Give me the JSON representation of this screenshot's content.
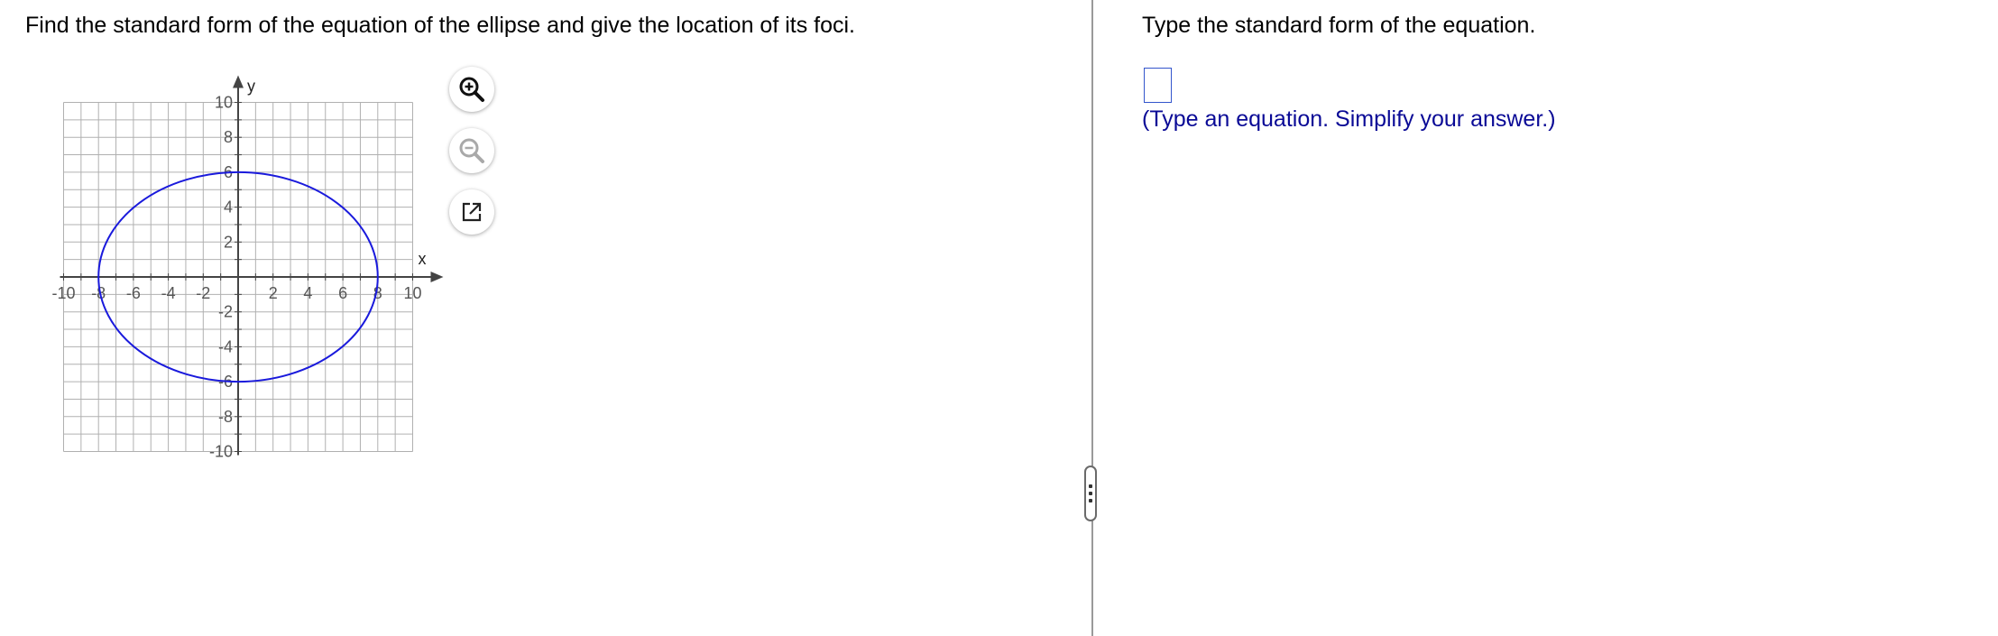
{
  "question": {
    "text": "Find the standard form of the equation of the ellipse and give the location of its foci."
  },
  "graph": {
    "x_axis_label": "x",
    "y_axis_label": "y",
    "x_range": [
      -10,
      10
    ],
    "y_range": [
      -10,
      10
    ],
    "grid_step": 1,
    "x_tick_labels": [
      "-10",
      "-8",
      "-6",
      "-4",
      "-2",
      "2",
      "4",
      "6",
      "8",
      "10"
    ],
    "y_tick_labels": [
      "10",
      "8",
      "6",
      "4",
      "2",
      "-2",
      "-4",
      "-6",
      "-8",
      "-10"
    ],
    "ellipse": {
      "center": [
        0,
        0
      ],
      "semi_axis_x": 8,
      "semi_axis_y": 6
    },
    "ellipse_color": "#1a1adc",
    "grid_color": "#b0b0b0",
    "axis_color": "#444444"
  },
  "tools": {
    "zoom_in": "zoom-in-icon",
    "zoom_out": "zoom-out-icon",
    "popout": "popout-icon"
  },
  "answer": {
    "instruction": "Type the standard form of the equation.",
    "value": "",
    "hint": "(Type an equation. Simplify your answer.)"
  }
}
